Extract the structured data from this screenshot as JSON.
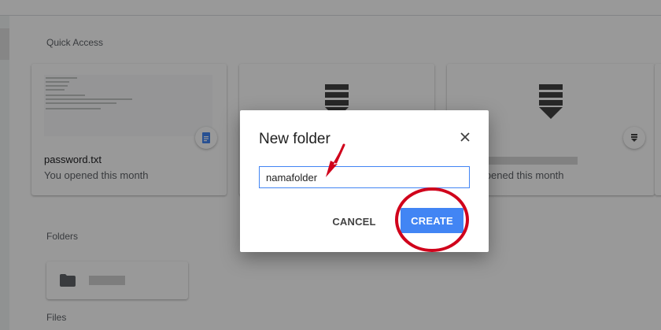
{
  "page": {
    "quick_access_label": "Quick Access",
    "folders_label": "Folders",
    "files_label": "Files"
  },
  "quick_access": [
    {
      "name": "password.txt",
      "subtitle": "You opened this month",
      "badge_icon": "google-docs-icon"
    },
    {
      "name": "",
      "subtitle": "",
      "badge_icon": "download-icon"
    },
    {
      "name": "",
      "subtitle": "You opened this month",
      "badge_icon": "download-icon"
    }
  ],
  "folders": [
    {
      "icon": "folder-icon"
    }
  ],
  "dialog": {
    "title": "New folder",
    "close_icon": "close-icon",
    "input_value": "namafolder",
    "cancel_label": "CANCEL",
    "create_label": "CREATE"
  },
  "colors": {
    "accent": "#4285f4",
    "annotation_red": "#d0021b",
    "scrim": "rgba(0,0,0,0.40)"
  }
}
